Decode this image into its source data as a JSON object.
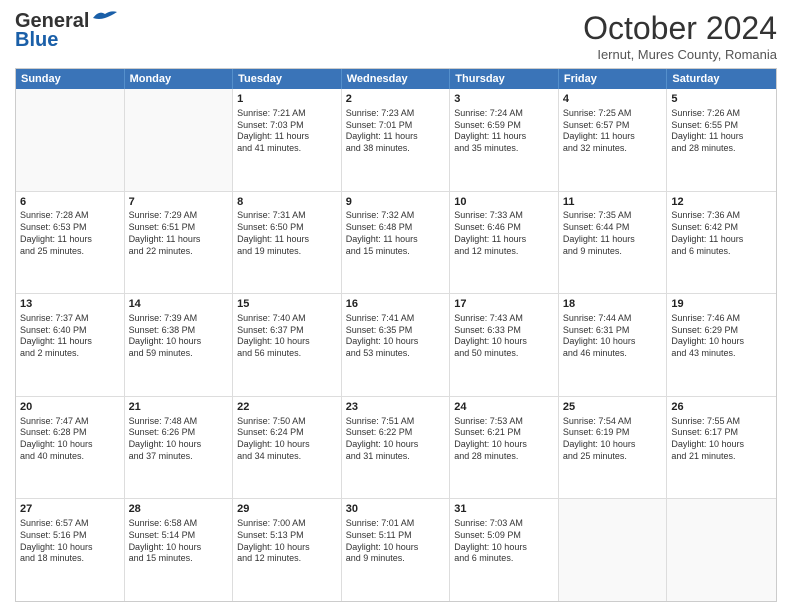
{
  "header": {
    "logo_line1": "General",
    "logo_line2": "Blue",
    "month": "October 2024",
    "location": "Iernut, Mures County, Romania"
  },
  "days_of_week": [
    "Sunday",
    "Monday",
    "Tuesday",
    "Wednesday",
    "Thursday",
    "Friday",
    "Saturday"
  ],
  "weeks": [
    [
      {
        "day": "",
        "empty": true
      },
      {
        "day": "",
        "empty": true
      },
      {
        "day": "1",
        "lines": [
          "Sunrise: 7:21 AM",
          "Sunset: 7:03 PM",
          "Daylight: 11 hours",
          "and 41 minutes."
        ]
      },
      {
        "day": "2",
        "lines": [
          "Sunrise: 7:23 AM",
          "Sunset: 7:01 PM",
          "Daylight: 11 hours",
          "and 38 minutes."
        ]
      },
      {
        "day": "3",
        "lines": [
          "Sunrise: 7:24 AM",
          "Sunset: 6:59 PM",
          "Daylight: 11 hours",
          "and 35 minutes."
        ]
      },
      {
        "day": "4",
        "lines": [
          "Sunrise: 7:25 AM",
          "Sunset: 6:57 PM",
          "Daylight: 11 hours",
          "and 32 minutes."
        ]
      },
      {
        "day": "5",
        "lines": [
          "Sunrise: 7:26 AM",
          "Sunset: 6:55 PM",
          "Daylight: 11 hours",
          "and 28 minutes."
        ]
      }
    ],
    [
      {
        "day": "6",
        "lines": [
          "Sunrise: 7:28 AM",
          "Sunset: 6:53 PM",
          "Daylight: 11 hours",
          "and 25 minutes."
        ]
      },
      {
        "day": "7",
        "lines": [
          "Sunrise: 7:29 AM",
          "Sunset: 6:51 PM",
          "Daylight: 11 hours",
          "and 22 minutes."
        ]
      },
      {
        "day": "8",
        "lines": [
          "Sunrise: 7:31 AM",
          "Sunset: 6:50 PM",
          "Daylight: 11 hours",
          "and 19 minutes."
        ]
      },
      {
        "day": "9",
        "lines": [
          "Sunrise: 7:32 AM",
          "Sunset: 6:48 PM",
          "Daylight: 11 hours",
          "and 15 minutes."
        ]
      },
      {
        "day": "10",
        "lines": [
          "Sunrise: 7:33 AM",
          "Sunset: 6:46 PM",
          "Daylight: 11 hours",
          "and 12 minutes."
        ]
      },
      {
        "day": "11",
        "lines": [
          "Sunrise: 7:35 AM",
          "Sunset: 6:44 PM",
          "Daylight: 11 hours",
          "and 9 minutes."
        ]
      },
      {
        "day": "12",
        "lines": [
          "Sunrise: 7:36 AM",
          "Sunset: 6:42 PM",
          "Daylight: 11 hours",
          "and 6 minutes."
        ]
      }
    ],
    [
      {
        "day": "13",
        "lines": [
          "Sunrise: 7:37 AM",
          "Sunset: 6:40 PM",
          "Daylight: 11 hours",
          "and 2 minutes."
        ]
      },
      {
        "day": "14",
        "lines": [
          "Sunrise: 7:39 AM",
          "Sunset: 6:38 PM",
          "Daylight: 10 hours",
          "and 59 minutes."
        ]
      },
      {
        "day": "15",
        "lines": [
          "Sunrise: 7:40 AM",
          "Sunset: 6:37 PM",
          "Daylight: 10 hours",
          "and 56 minutes."
        ]
      },
      {
        "day": "16",
        "lines": [
          "Sunrise: 7:41 AM",
          "Sunset: 6:35 PM",
          "Daylight: 10 hours",
          "and 53 minutes."
        ]
      },
      {
        "day": "17",
        "lines": [
          "Sunrise: 7:43 AM",
          "Sunset: 6:33 PM",
          "Daylight: 10 hours",
          "and 50 minutes."
        ]
      },
      {
        "day": "18",
        "lines": [
          "Sunrise: 7:44 AM",
          "Sunset: 6:31 PM",
          "Daylight: 10 hours",
          "and 46 minutes."
        ]
      },
      {
        "day": "19",
        "lines": [
          "Sunrise: 7:46 AM",
          "Sunset: 6:29 PM",
          "Daylight: 10 hours",
          "and 43 minutes."
        ]
      }
    ],
    [
      {
        "day": "20",
        "lines": [
          "Sunrise: 7:47 AM",
          "Sunset: 6:28 PM",
          "Daylight: 10 hours",
          "and 40 minutes."
        ]
      },
      {
        "day": "21",
        "lines": [
          "Sunrise: 7:48 AM",
          "Sunset: 6:26 PM",
          "Daylight: 10 hours",
          "and 37 minutes."
        ]
      },
      {
        "day": "22",
        "lines": [
          "Sunrise: 7:50 AM",
          "Sunset: 6:24 PM",
          "Daylight: 10 hours",
          "and 34 minutes."
        ]
      },
      {
        "day": "23",
        "lines": [
          "Sunrise: 7:51 AM",
          "Sunset: 6:22 PM",
          "Daylight: 10 hours",
          "and 31 minutes."
        ]
      },
      {
        "day": "24",
        "lines": [
          "Sunrise: 7:53 AM",
          "Sunset: 6:21 PM",
          "Daylight: 10 hours",
          "and 28 minutes."
        ]
      },
      {
        "day": "25",
        "lines": [
          "Sunrise: 7:54 AM",
          "Sunset: 6:19 PM",
          "Daylight: 10 hours",
          "and 25 minutes."
        ]
      },
      {
        "day": "26",
        "lines": [
          "Sunrise: 7:55 AM",
          "Sunset: 6:17 PM",
          "Daylight: 10 hours",
          "and 21 minutes."
        ]
      }
    ],
    [
      {
        "day": "27",
        "lines": [
          "Sunrise: 6:57 AM",
          "Sunset: 5:16 PM",
          "Daylight: 10 hours",
          "and 18 minutes."
        ]
      },
      {
        "day": "28",
        "lines": [
          "Sunrise: 6:58 AM",
          "Sunset: 5:14 PM",
          "Daylight: 10 hours",
          "and 15 minutes."
        ]
      },
      {
        "day": "29",
        "lines": [
          "Sunrise: 7:00 AM",
          "Sunset: 5:13 PM",
          "Daylight: 10 hours",
          "and 12 minutes."
        ]
      },
      {
        "day": "30",
        "lines": [
          "Sunrise: 7:01 AM",
          "Sunset: 5:11 PM",
          "Daylight: 10 hours",
          "and 9 minutes."
        ]
      },
      {
        "day": "31",
        "lines": [
          "Sunrise: 7:03 AM",
          "Sunset: 5:09 PM",
          "Daylight: 10 hours",
          "and 6 minutes."
        ]
      },
      {
        "day": "",
        "empty": true
      },
      {
        "day": "",
        "empty": true
      }
    ]
  ]
}
